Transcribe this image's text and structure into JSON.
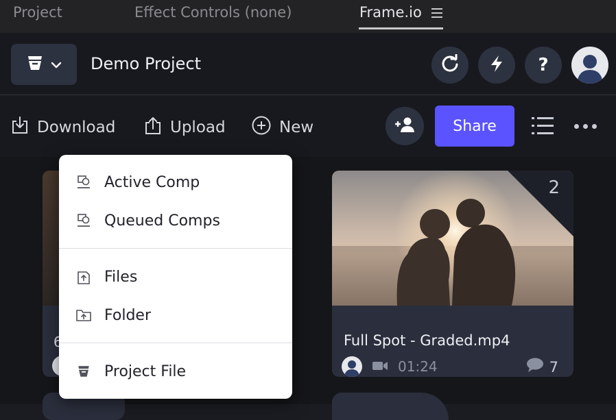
{
  "panel_tabs": [
    {
      "label": "Project",
      "active": false
    },
    {
      "label": "Effect Controls (none)",
      "active": false
    },
    {
      "label": "Frame.io",
      "active": true
    }
  ],
  "header": {
    "project_title": "Demo Project",
    "icons": [
      "frameio-logo-icon",
      "chevron-down-icon",
      "refresh-icon",
      "lightning-icon",
      "help-icon",
      "user-avatar"
    ]
  },
  "toolbar": {
    "download_label": "Download",
    "upload_label": "Upload",
    "new_label": "New",
    "share_label": "Share"
  },
  "upload_menu": {
    "items": [
      {
        "label": "Active Comp",
        "icon": "comp-icon"
      },
      {
        "label": "Queued Comps",
        "icon": "comp-icon"
      },
      {
        "label": "Files",
        "icon": "file-upload-icon"
      },
      {
        "label": "Folder",
        "icon": "folder-upload-icon"
      },
      {
        "label": "Project File",
        "icon": "frameio-logo-icon"
      }
    ]
  },
  "assets": {
    "left_card_peek": "6",
    "card": {
      "version_count": "2",
      "filename": "Full Spot - Graded.mp4",
      "duration": "01:24",
      "comment_count": "7"
    }
  },
  "colors": {
    "accent": "#5b53ff",
    "background": "#18191e",
    "card": "#2b2f3d",
    "menu": "#ffffff"
  }
}
